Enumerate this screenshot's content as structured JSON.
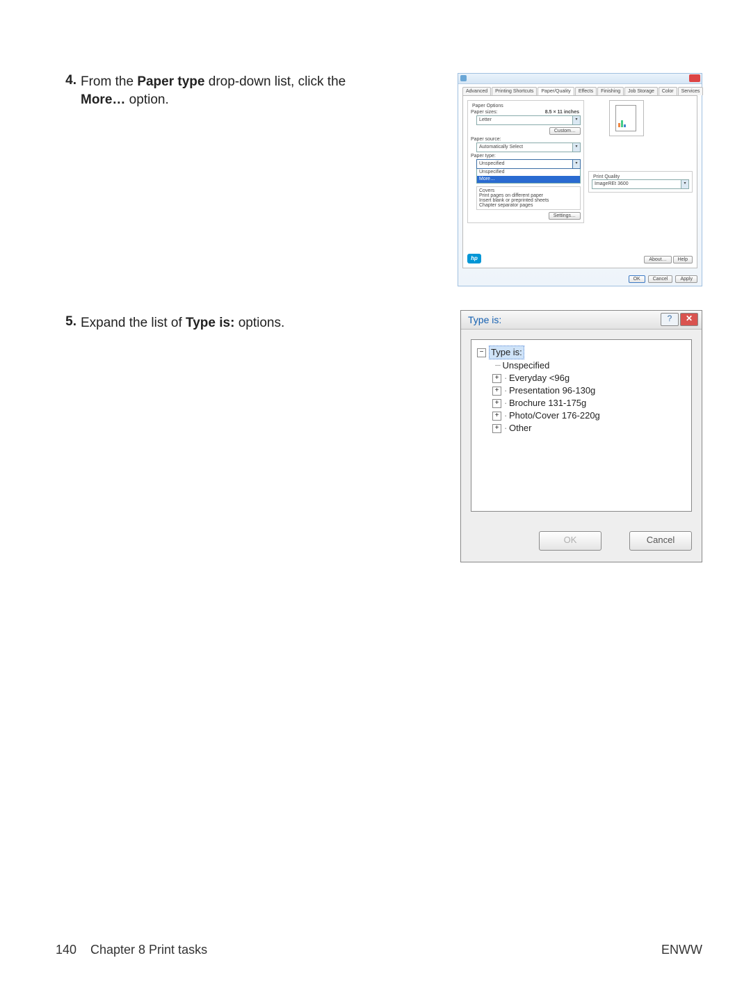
{
  "steps": {
    "s4": {
      "num": "4.",
      "pre": "From the ",
      "b1": "Paper type",
      "mid": " drop-down list, click the ",
      "b2": "More…",
      "post": " option."
    },
    "s5": {
      "num": "5.",
      "pre": "Expand the list of ",
      "b1": "Type is:",
      "post": " options."
    }
  },
  "dlg1": {
    "tabs": {
      "t0": "Advanced",
      "t1": "Printing Shortcuts",
      "t2": "Paper/Quality",
      "t3": "Effects",
      "t4": "Finishing",
      "t5": "Job Storage",
      "t6": "Color",
      "t7": "Services"
    },
    "grp_paper_options": "Paper Options",
    "lbl_paper_sizes": "Paper sizes:",
    "val_paper_size": "8.5 × 11 inches",
    "combo_letter": "Letter",
    "btn_custom": "Custom…",
    "lbl_paper_source": "Paper source:",
    "combo_source": "Automatically Select",
    "lbl_paper_type": "Paper type:",
    "combo_type": "Unspecified",
    "dd": {
      "i0": "Unspecified",
      "i1": "More…"
    },
    "sp": {
      "i0": "Covers",
      "i1": "Print pages on different paper",
      "i2": "Insert blank or preprinted sheets",
      "i3": "Chapter separator pages"
    },
    "btn_settings": "Settings…",
    "grp_print_quality": "Print Quality",
    "combo_quality": "ImageREt 3600",
    "hp": "hp",
    "btn_about": "About…",
    "btn_help": "Help",
    "btn_ok": "OK",
    "btn_cancel": "Cancel",
    "btn_apply": "Apply"
  },
  "dlg2": {
    "title": "Type is:",
    "help_glyph": "?",
    "close_glyph": "✕",
    "minus": "−",
    "plus": "+",
    "root": "Type is:",
    "items": {
      "i0": "Unspecified",
      "i1": "Everyday <96g",
      "i2": "Presentation 96-130g",
      "i3": "Brochure 131-175g",
      "i4": "Photo/Cover 176-220g",
      "i5": "Other"
    },
    "btn_ok": "OK",
    "btn_cancel": "Cancel"
  },
  "footer": {
    "page_no": "140",
    "chapter": "Chapter 8   Print tasks",
    "right": "ENWW"
  }
}
